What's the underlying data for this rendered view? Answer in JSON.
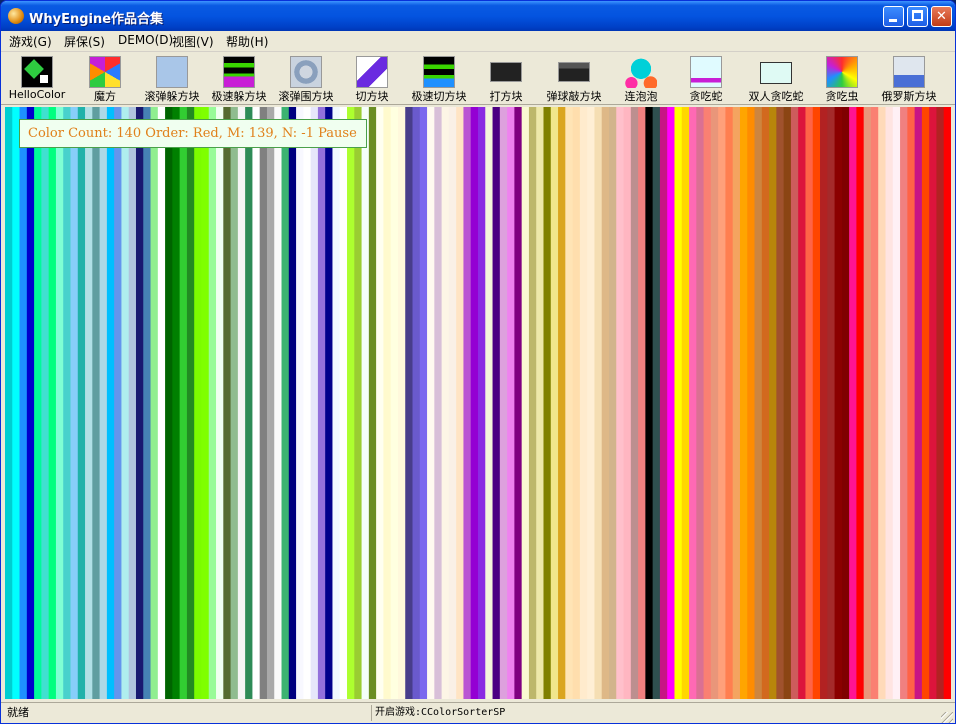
{
  "window": {
    "title": "WhyEngine作品合集",
    "minimize_label": "Minimize",
    "maximize_label": "Maximize",
    "close_label": "Close"
  },
  "menu": [
    {
      "label": "游戏(G)"
    },
    {
      "label": "屏保(S)"
    },
    {
      "label": "DEMO(D)"
    },
    {
      "label": "视图(V)"
    },
    {
      "label": "帮助(H)"
    }
  ],
  "toolbar": [
    {
      "label": "HelloColor",
      "icon": "hello-color-icon"
    },
    {
      "label": "魔方",
      "icon": "rubiks-cube-icon"
    },
    {
      "label": "滚弹躲方块",
      "icon": "roll-dodge-blocks-icon"
    },
    {
      "label": "极速躲方块",
      "icon": "speed-dodge-blocks-icon"
    },
    {
      "label": "滚弹围方块",
      "icon": "roll-surround-blocks-icon"
    },
    {
      "label": "切方块",
      "icon": "cut-blocks-icon"
    },
    {
      "label": "极速切方块",
      "icon": "speed-cut-blocks-icon"
    },
    {
      "label": "打方块",
      "icon": "hit-blocks-icon"
    },
    {
      "label": "弹球敲方块",
      "icon": "pinball-blocks-icon"
    },
    {
      "label": "连泡泡",
      "icon": "bubbles-icon"
    },
    {
      "label": "贪吃蛇",
      "icon": "snake-icon"
    },
    {
      "label": "双人贪吃蛇",
      "icon": "two-player-snake-icon"
    },
    {
      "label": "贪吃虫",
      "icon": "worm-icon"
    },
    {
      "label": "俄罗斯方块",
      "icon": "tetris-icon"
    }
  ],
  "canvas": {
    "info_text": "Color Count: 140 Order: Red, M: 139, N: -1  Pause",
    "stripe_colors": [
      "#00ced1",
      "#00ffff",
      "#1e90ff",
      "#0000cd",
      "#00fa9a",
      "#40e0d0",
      "#00ff7f",
      "#7fffd4",
      "#48d1cc",
      "#87cefa",
      "#20b2aa",
      "#b0e0e6",
      "#5f9ea0",
      "#add8e6",
      "#00bfff",
      "#6495ed",
      "#afeeee",
      "#b0c4de",
      "#191970",
      "#4682b4",
      "#90ee90",
      "#ffffff",
      "#006400",
      "#008000",
      "#32cd32",
      "#228b22",
      "#7cfc00",
      "#7fff00",
      "#98fb98",
      "#f0fff0",
      "#556b2f",
      "#8fbc8f",
      "#f5f5f5",
      "#2e8b57",
      "#ffffff",
      "#808080",
      "#a9a9a9",
      "#fafafa",
      "#3cb371",
      "#000080",
      "#f8f8ff",
      "#ffffff",
      "#e6e6fa",
      "#9370db",
      "#00008b",
      "#f0f8ff",
      "#ffffff",
      "#adff2f",
      "#9acd32",
      "#f5fffa",
      "#6b8e23",
      "#fffff0",
      "#fffacd",
      "#ffffe0",
      "#fff8dc",
      "#483d8b",
      "#6a5acd",
      "#7b68ee",
      "#fffaf0",
      "#d8bfd8",
      "#fdf5e6",
      "#faf0e6",
      "#ffe4c4",
      "#ba55d3",
      "#9400d3",
      "#8a2be2",
      "#f5f5dc",
      "#4b0082",
      "#dda0dd",
      "#ee82ee",
      "#800080",
      "#fafad2",
      "#bdb76b",
      "#eee8aa",
      "#808000",
      "#f0e68c",
      "#daa520",
      "#ffe4b5",
      "#ffdead",
      "#ffebcd",
      "#ffefd5",
      "#f5deb3",
      "#deb887",
      "#d2b48c",
      "#ffc0cb",
      "#ffb6c1",
      "#bc8f8f",
      "#f08080",
      "#000000",
      "#2f4f4f",
      "#c71585",
      "#ff00ff",
      "#ffff00",
      "#ffd700",
      "#ff69b4",
      "#db7093",
      "#fa8072",
      "#e9967a",
      "#ffa07a",
      "#ff7f50",
      "#f4a460",
      "#ffa500",
      "#ff8c00",
      "#cd853f",
      "#d2691e",
      "#b8860b",
      "#a0522d",
      "#8b4513",
      "#cd5c5c",
      "#dc143c",
      "#ff6347",
      "#ff4500",
      "#b22222",
      "#a52a2a",
      "#8b0000",
      "#800000",
      "#ff1493",
      "#ff0000",
      "#e9967a",
      "#fa8072",
      "#ffdab9",
      "#ffe4e1",
      "#fff0f5",
      "#f08080",
      "#ff6347",
      "#c71585",
      "#ff4500",
      "#dc143c",
      "#b22222",
      "#ff0000"
    ]
  },
  "status": {
    "left": "就绪",
    "right": "开启游戏:CColorSorterSP"
  }
}
